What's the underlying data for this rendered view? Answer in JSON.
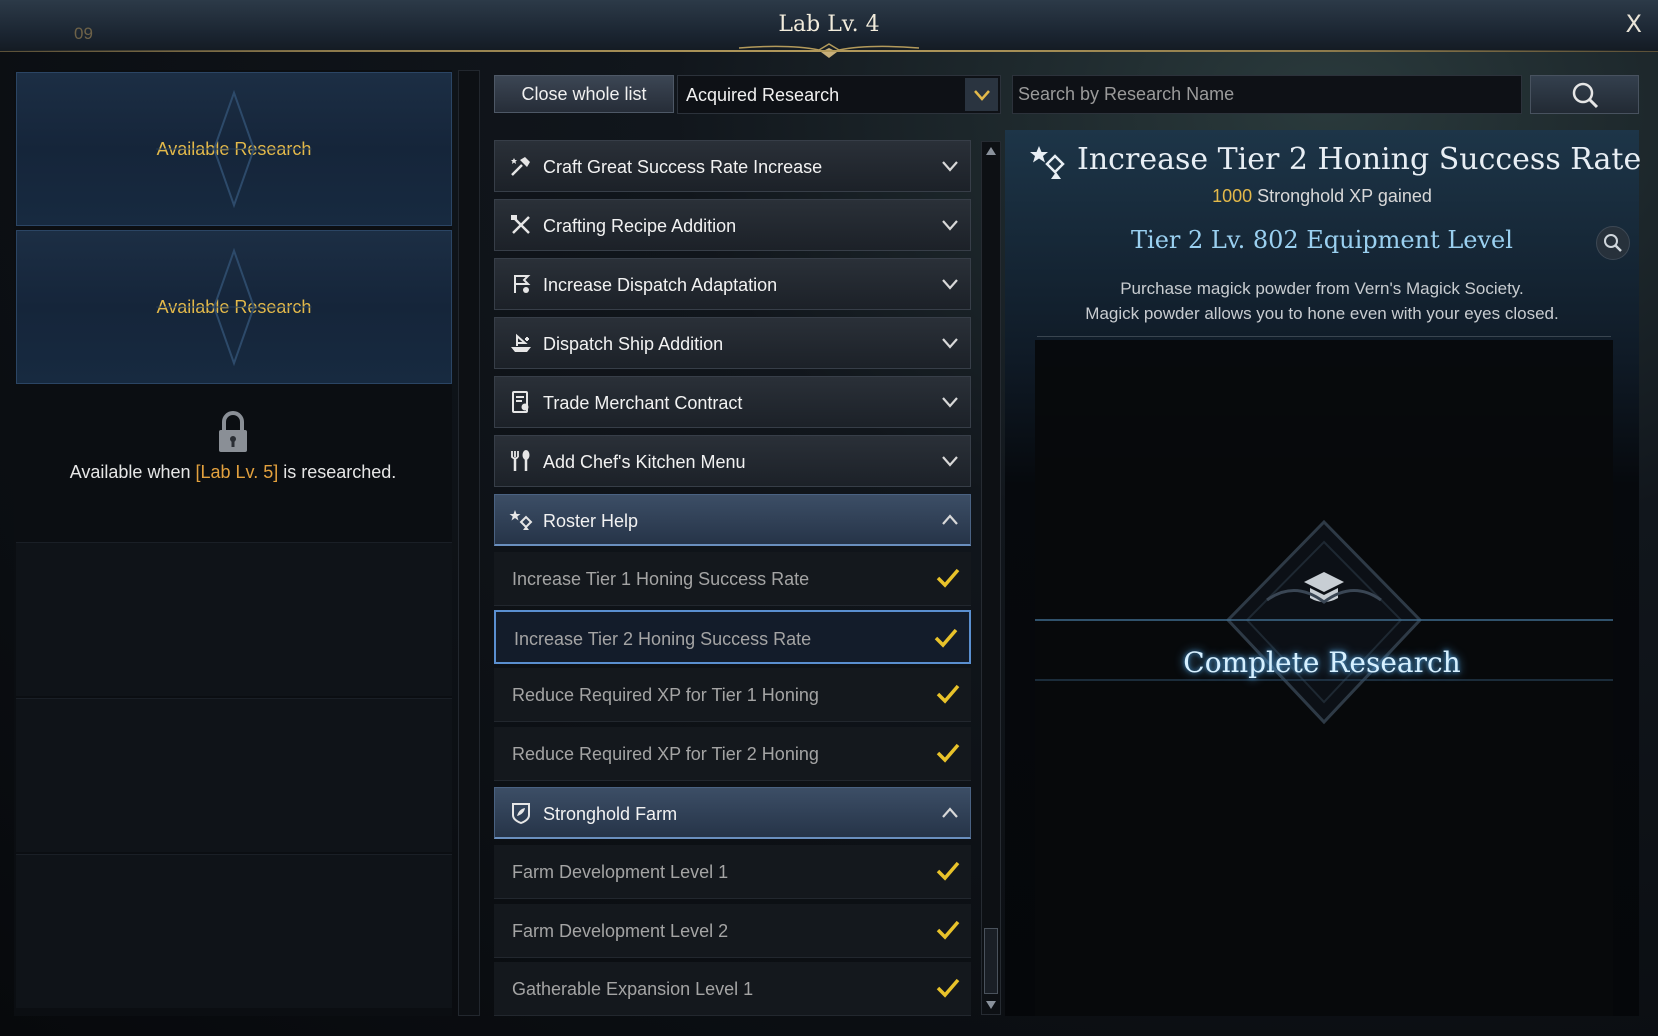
{
  "window": {
    "corner_number": "09",
    "title": "Lab Lv. 4",
    "close_label": "X"
  },
  "left_panel": {
    "slots": [
      {
        "label": "Available Research"
      },
      {
        "label": "Available Research"
      }
    ],
    "lock": {
      "text_before": "Available when ",
      "requirement": "[Lab Lv. 5]",
      "text_after": " is researched."
    }
  },
  "toolbar": {
    "close_list_label": "Close whole list",
    "filter_value": "Acquired Research",
    "search_placeholder": "Search by Research Name"
  },
  "list": {
    "categories": [
      {
        "label": "Craft Great Success Rate Increase",
        "icon": "craft-hammer-star-icon",
        "expanded": false
      },
      {
        "label": "Crafting Recipe Addition",
        "icon": "crossed-tools-icon",
        "expanded": false
      },
      {
        "label": "Increase Dispatch Adaptation",
        "icon": "dispatch-flag-icon",
        "expanded": false
      },
      {
        "label": "Dispatch Ship Addition",
        "icon": "ship-icon",
        "expanded": false
      },
      {
        "label": "Trade Merchant Contract",
        "icon": "contract-icon",
        "expanded": false
      },
      {
        "label": "Add Chef's Kitchen Menu",
        "icon": "fork-spoon-icon",
        "expanded": false
      },
      {
        "label": "Roster Help",
        "icon": "roster-star-icon",
        "expanded": true
      },
      {
        "label": "Stronghold Farm",
        "icon": "farm-shield-icon",
        "expanded": true
      }
    ],
    "roster_items": [
      {
        "label": "Increase Tier 1 Honing Success Rate",
        "acquired": true
      },
      {
        "label": "Increase Tier 2 Honing Success Rate",
        "acquired": true,
        "selected": true
      },
      {
        "label": "Reduce Required XP for Tier 1 Honing",
        "acquired": true
      },
      {
        "label": "Reduce Required XP for Tier 2 Honing",
        "acquired": true
      }
    ],
    "farm_items": [
      {
        "label": "Farm Development Level 1",
        "acquired": true
      },
      {
        "label": "Farm Development Level 2",
        "acquired": true
      },
      {
        "label": "Gatherable Expansion Level 1",
        "acquired": true
      }
    ]
  },
  "detail": {
    "title": "Increase Tier 2 Honing Success Rate",
    "xp_value": "1000",
    "xp_suffix": " Stronghold XP gained",
    "equipment_level": "Tier 2 Lv. 802 Equipment Level",
    "description_line1": "Purchase magick powder from Vern's Magick Society.",
    "description_line2": "Magick powder allows you to hone even with your eyes closed.",
    "status": "Complete Research"
  },
  "colors": {
    "gold": "#e3b94a",
    "accent_blue": "#5a8fd0",
    "check_yellow": "#e8c22a"
  }
}
